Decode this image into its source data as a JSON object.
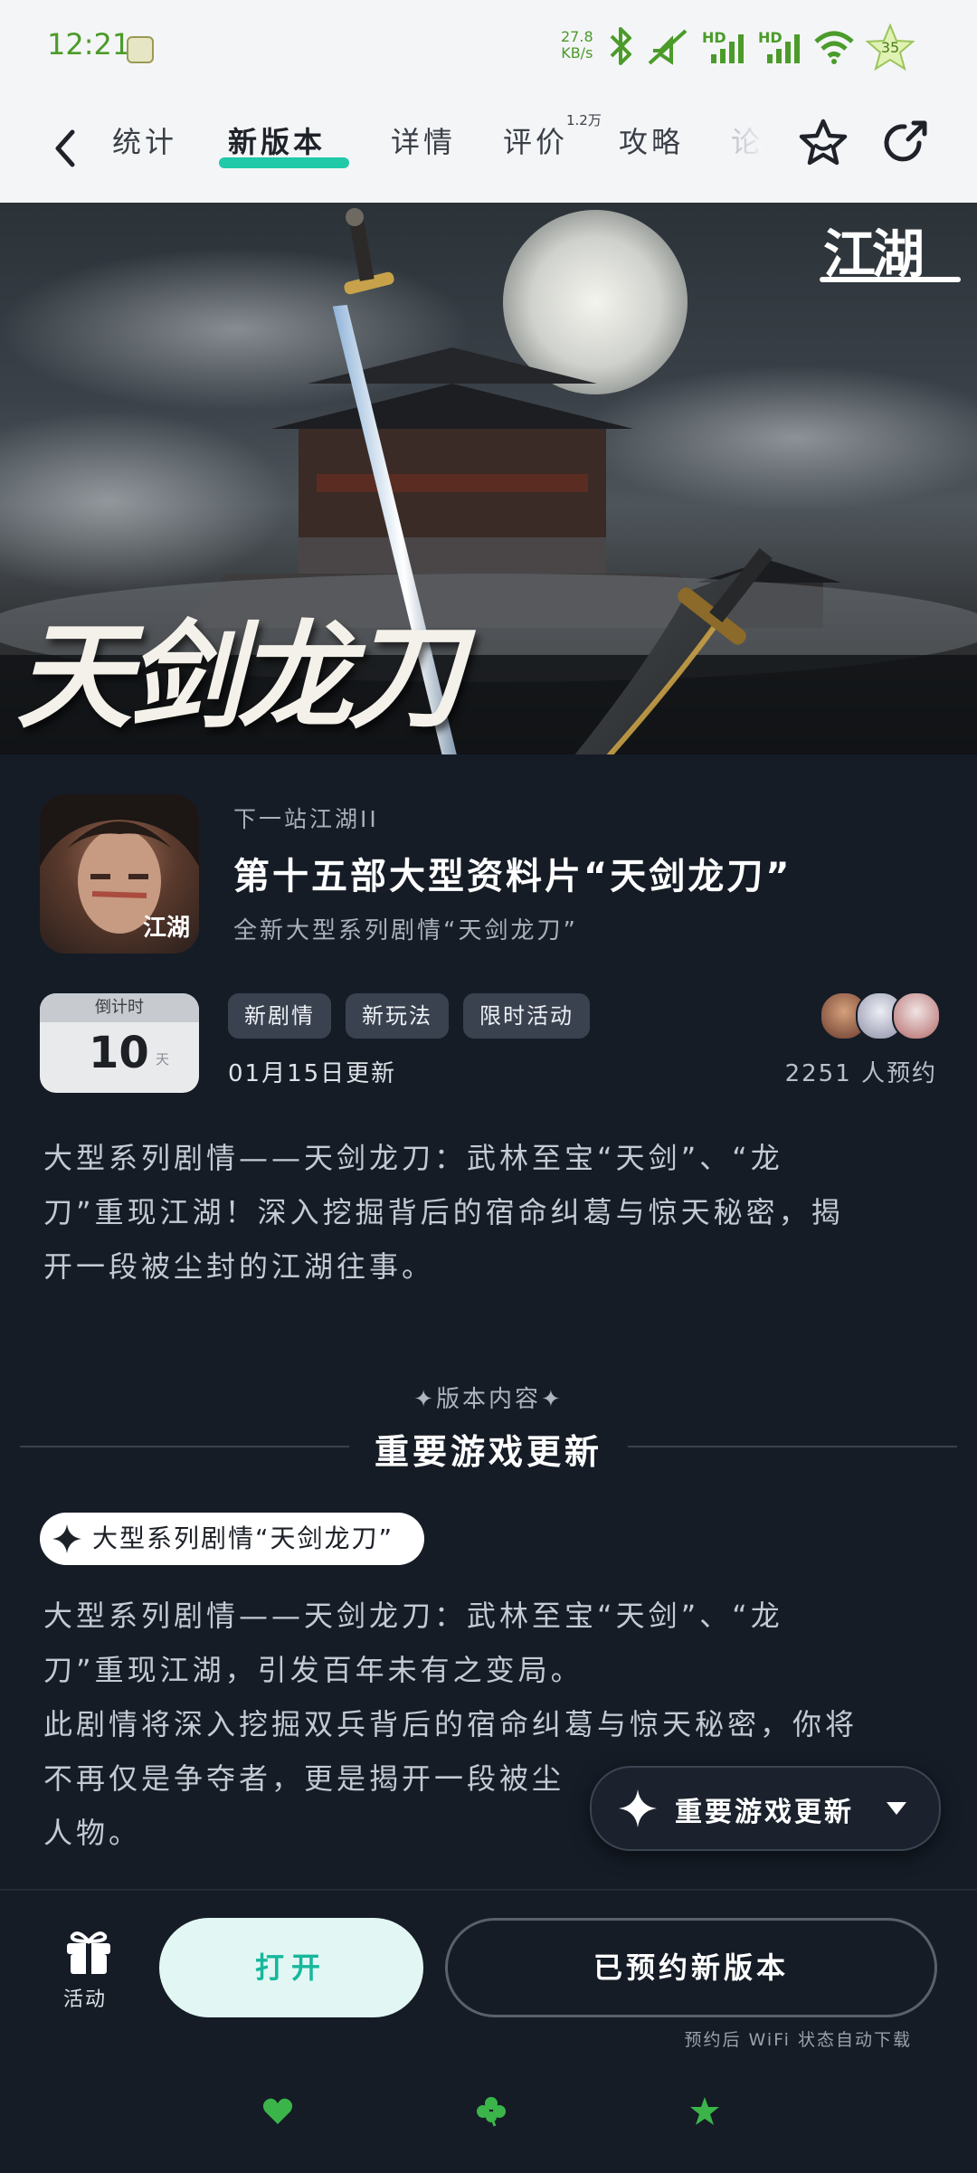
{
  "status_bar": {
    "time": "12:21",
    "net_speed_value": "27.8",
    "net_speed_unit": "KB/s",
    "hd1": "HD",
    "hd2": "HD",
    "battery": "35"
  },
  "nav": {
    "tabs": [
      {
        "label": "统计"
      },
      {
        "label": "新版本"
      },
      {
        "label": "详情"
      },
      {
        "label": "评价"
      },
      {
        "label": "攻略"
      },
      {
        "label": "论坛"
      }
    ],
    "active_tab": 1,
    "reviews_badge": "1.2万"
  },
  "banner": {
    "title": "天剑龙刀",
    "logo_text": "江湖"
  },
  "game": {
    "icon_tag": "江湖",
    "eyebrow": "下一站江湖II",
    "title": "第十五部大型资料片“天剑龙刀”",
    "subtitle": "全新大型系列剧情“天剑龙刀”"
  },
  "countdown": {
    "label": "倒计时",
    "value": "10",
    "unit": "天"
  },
  "tags": [
    "新剧情",
    "新玩法",
    "限时活动"
  ],
  "update_date": "01月15日更新",
  "reservations": "2251 人预约",
  "intro": {
    "line1": "大型系列剧情——天剑龙刀：武林至宝“天剑”、“龙",
    "line2": "刀”重现江湖！深入挖掘背后的宿命纠葛与惊天秘密，揭",
    "line3": "开一段被尘封的江湖往事。"
  },
  "section": {
    "eyebrow": "✦版本内容✦",
    "title": "重要游戏更新"
  },
  "feature": {
    "pill_label": "大型系列剧情“天剑龙刀”",
    "line1": "大型系列剧情——天剑龙刀：武林至宝“天剑”、“龙",
    "line2": "刀”重现江湖，引发百年未有之变局。",
    "line3": "此剧情将深入挖掘双兵背后的宿命纠葛与惊天秘密，你将",
    "line4": "不再仅是争夺者，更是揭开一段被尘",
    "line5": "人物。"
  },
  "floating_menu": {
    "label": "重要游戏更新"
  },
  "bottom": {
    "activity_label": "活动",
    "open_label": "打开",
    "reserved_label": "已预约新版本",
    "wifi_note": "预约后 WiFi 状态自动下载"
  },
  "colors": {
    "accent": "#20c9a8",
    "page_bg": "#151c26",
    "status_green": "#4b9b2a",
    "dock_green": "#3bb54a"
  },
  "icons": {
    "back": "chevron-left-icon",
    "star": "star-outline-icon",
    "share": "share-arrow-icon",
    "gift": "gift-icon",
    "sparkle": "sparkle-icon",
    "caret": "caret-down-icon",
    "dock": [
      "heart-icon",
      "clover-icon",
      "star-icon"
    ]
  }
}
